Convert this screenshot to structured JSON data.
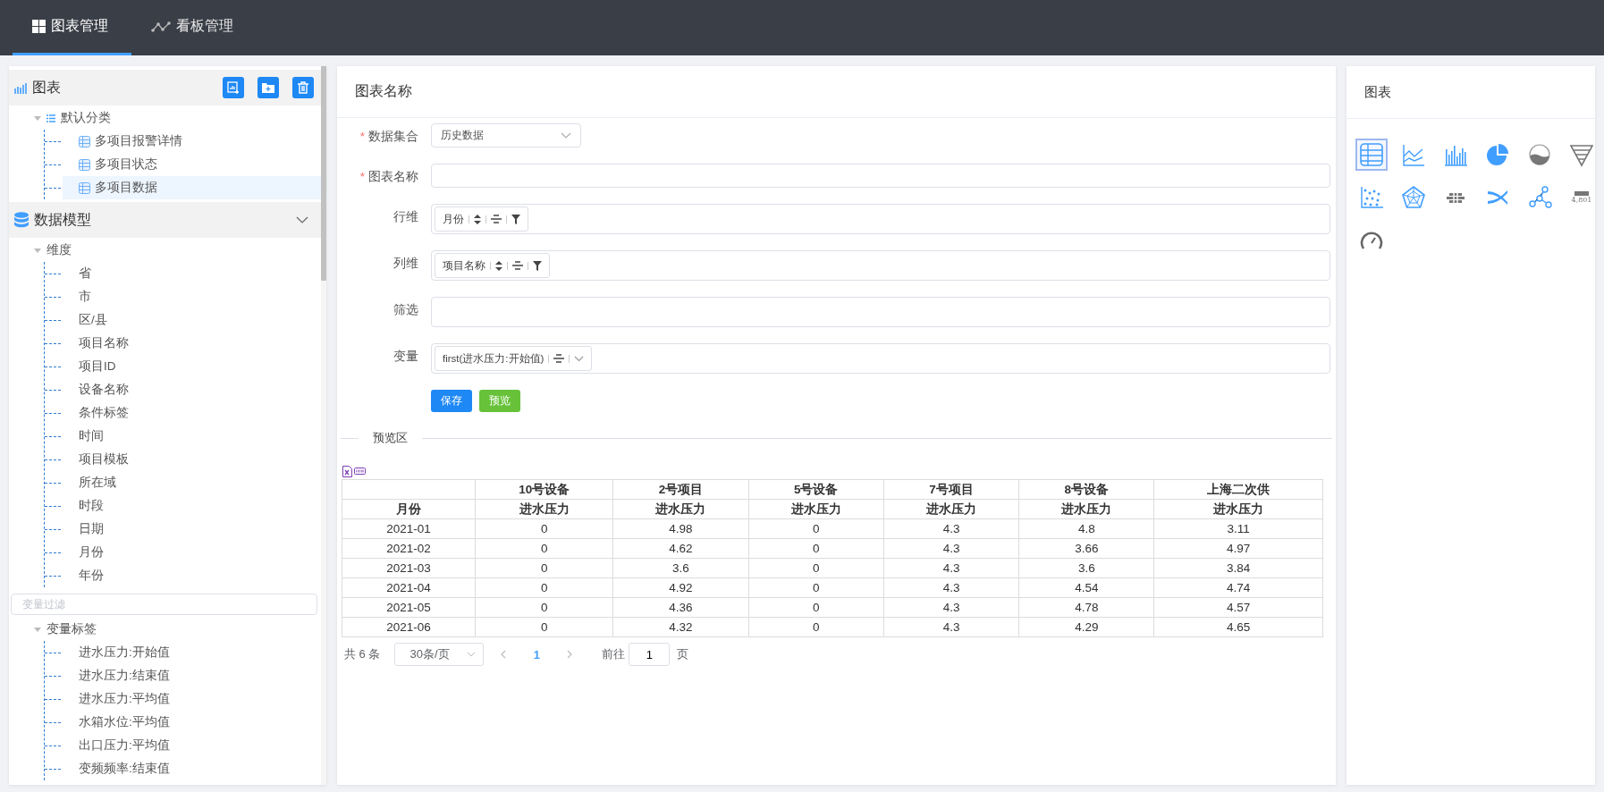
{
  "nav": {
    "tabs": [
      {
        "label": "图表管理",
        "selected": true
      },
      {
        "label": "看板管理",
        "selected": false
      }
    ]
  },
  "sidebar": {
    "charts": {
      "title": "图表",
      "tree": [
        {
          "label": "默认分类",
          "expanded": true,
          "children": [
            {
              "label": "多项目报警详情",
              "selected": false
            },
            {
              "label": "多项目状态",
              "selected": false
            },
            {
              "label": "多项目数据",
              "selected": true
            }
          ]
        }
      ]
    },
    "model": {
      "title": "数据模型",
      "expanded": true,
      "dimensions": {
        "label": "维度",
        "expanded": true,
        "children": [
          {
            "label": "省"
          },
          {
            "label": "市"
          },
          {
            "label": "区/县"
          },
          {
            "label": "项目名称"
          },
          {
            "label": "项目ID"
          },
          {
            "label": "设备名称"
          },
          {
            "label": "条件标签"
          },
          {
            "label": "时间"
          },
          {
            "label": "项目模板"
          },
          {
            "label": "所在域"
          },
          {
            "label": "时段"
          },
          {
            "label": "日期"
          },
          {
            "label": "月份"
          },
          {
            "label": "年份"
          }
        ]
      },
      "filter": {
        "placeholder": "变量过滤"
      },
      "variables": {
        "label": "变量标签",
        "expanded": true,
        "children": [
          {
            "label": "进水压力:开始值"
          },
          {
            "label": "进水压力:结束值"
          },
          {
            "label": "进水压力:平均值"
          },
          {
            "label": "水箱水位:平均值"
          },
          {
            "label": "出口压力:平均值"
          },
          {
            "label": "变频频率:结束值"
          }
        ]
      }
    }
  },
  "editor": {
    "title": "图表名称",
    "required_mark": "*",
    "rows": [
      {
        "label": "数据集合",
        "required": true,
        "kind": "select",
        "value": "历史数据"
      },
      {
        "label": "图表名称",
        "required": true,
        "kind": "input"
      },
      {
        "label": "行维",
        "required": false,
        "kind": "chips",
        "chips": [
          {
            "label": "月份"
          }
        ]
      },
      {
        "label": "列维",
        "required": false,
        "kind": "chips",
        "chips": [
          {
            "label": "项目名称"
          }
        ]
      },
      {
        "label": "筛选",
        "required": false,
        "kind": "chips"
      },
      {
        "label": "变量",
        "required": false,
        "kind": "measures",
        "chips": [
          {
            "label": "first(进水压力:开始值)"
          }
        ]
      }
    ],
    "buttons": [
      {
        "label": "保存",
        "kind": "primary"
      },
      {
        "label": "预览",
        "kind": "success"
      }
    ],
    "preview": {
      "title": "预览区",
      "table": {
        "row_header": "月份",
        "columns": [
          {
            "group": "10号设备",
            "label": "进水压力"
          },
          {
            "group": "2号项目",
            "label": "进水压力"
          },
          {
            "group": "5号设备",
            "label": "进水压力"
          },
          {
            "group": "7号项目",
            "label": "进水压力"
          },
          {
            "group": "8号设备",
            "label": "进水压力"
          },
          {
            "group": "上海二次供",
            "label": "进水压力"
          }
        ],
        "rows": [
          {
            "month": "2021-01",
            "cells": [
              "0",
              "4.98",
              "0",
              "4.3",
              "4.8",
              "3.11"
            ]
          },
          {
            "month": "2021-02",
            "cells": [
              "0",
              "4.62",
              "0",
              "4.3",
              "3.66",
              "4.97"
            ]
          },
          {
            "month": "2021-03",
            "cells": [
              "0",
              "3.6",
              "0",
              "4.3",
              "3.6",
              "3.84"
            ]
          },
          {
            "month": "2021-04",
            "cells": [
              "0",
              "4.92",
              "0",
              "4.3",
              "4.54",
              "4.74"
            ]
          },
          {
            "month": "2021-05",
            "cells": [
              "0",
              "4.36",
              "0",
              "4.3",
              "4.78",
              "4.57"
            ]
          },
          {
            "month": "2021-06",
            "cells": [
              "0",
              "4.32",
              "0",
              "4.3",
              "4.29",
              "4.65"
            ]
          }
        ]
      },
      "pagination": {
        "total": "共 6 条",
        "page_size": "30条/页",
        "pages": [
          {
            "label": "1",
            "selected": true
          }
        ],
        "goto_label": "前往",
        "goto_value": "1",
        "goto_suffix": "页"
      }
    }
  },
  "chart_panel": {
    "title": "图表",
    "chart_types": [
      {
        "kind": "table",
        "selected": true
      },
      {
        "kind": "line",
        "selected": false
      },
      {
        "kind": "bar",
        "selected": false
      },
      {
        "kind": "pie",
        "selected": false
      },
      {
        "kind": "liquid",
        "selected": false
      },
      {
        "kind": "funnel",
        "selected": false
      },
      {
        "kind": "scatter",
        "selected": false
      },
      {
        "kind": "radar",
        "selected": false
      },
      {
        "kind": "heatmap",
        "selected": false
      },
      {
        "kind": "sankey",
        "selected": false
      },
      {
        "kind": "graph",
        "selected": false
      },
      {
        "kind": "card",
        "selected": false,
        "label": "4,801"
      },
      {
        "kind": "gauge",
        "selected": false
      }
    ]
  }
}
